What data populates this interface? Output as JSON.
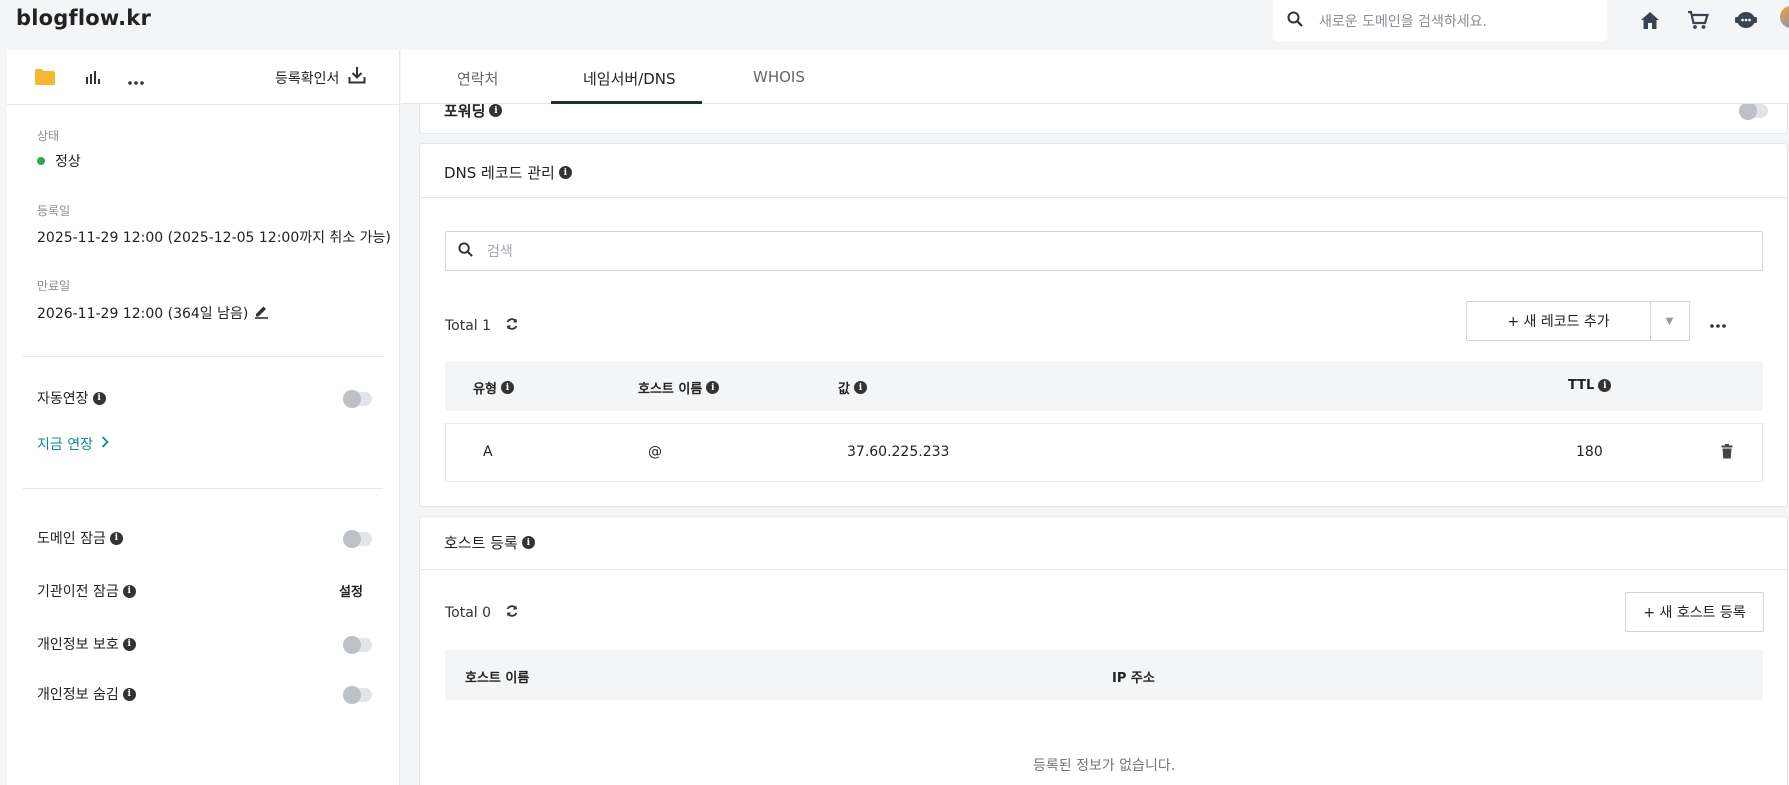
{
  "header": {
    "brand": "blogflow.kr",
    "search_placeholder": "새로운 도메인을 검색하세요.",
    "icons": [
      "home-icon",
      "cart-icon",
      "support-icon"
    ]
  },
  "left": {
    "cert_label": "등록확인서",
    "status_label": "상태",
    "status_value": "정상",
    "reg_label": "등록일",
    "reg_value": "2025-11-29 12:00 (2025-12-05 12:00까지 취소 가능)",
    "exp_label": "만료일",
    "exp_value": "2026-11-29 12:00 (364일 남음)",
    "auto_renew": "자동연장",
    "renew_now": "지금 연장",
    "domain_lock": "도메인 잠금",
    "transfer_lock": "기관이전 잠금",
    "transfer_lock_action": "설정",
    "privacy_protect": "개인정보 보호",
    "privacy_hide": "개인정보 숨김"
  },
  "tabs": [
    "연락처",
    "네임서버/DNS",
    "WHOIS"
  ],
  "forwarding": {
    "title": "포워딩"
  },
  "dns": {
    "title": "DNS 레코드 관리",
    "search_placeholder": "검색",
    "total": "Total 1",
    "add_button": "+ 새 레코드 추가",
    "columns": [
      "유형",
      "호스트 이름",
      "값",
      "TTL"
    ],
    "rows": [
      {
        "type": "A",
        "host": "@",
        "value": "37.60.225.233",
        "ttl": "180"
      }
    ]
  },
  "hosts": {
    "title": "호스트 등록",
    "total": "Total 0",
    "add_button": "+ 새 호스트 등록",
    "columns": [
      "호스트 이름",
      "IP 주소"
    ],
    "empty": "등록된 정보가 없습니다."
  },
  "colors": {
    "status_green": "#2ea84a",
    "folder": "#f5b731",
    "tab_underline": "#222d3a",
    "link": "#0f8b8d"
  }
}
